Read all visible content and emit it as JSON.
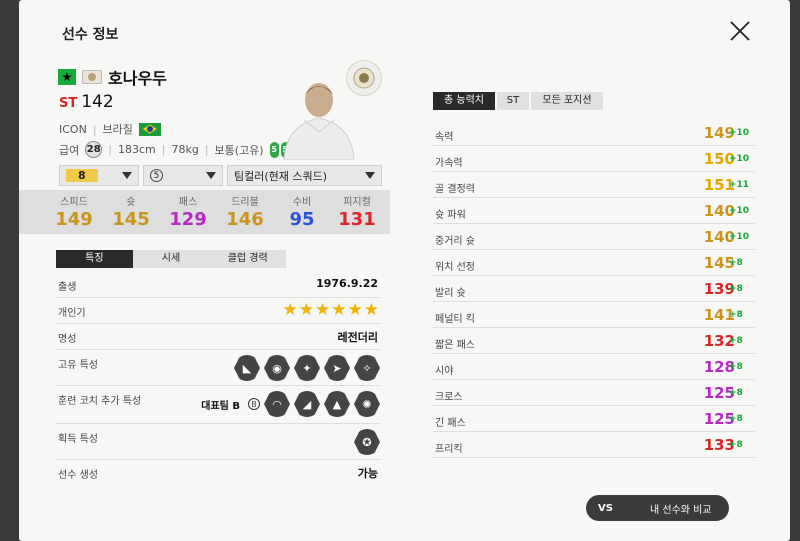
{
  "header": {
    "title": "선수 정보"
  },
  "player": {
    "name": "호나우두",
    "position": "ST",
    "overall": "142",
    "card_type": "ICON",
    "nation": "브라질",
    "salary_label": "급여",
    "salary": "28",
    "height": "183cm",
    "weight": "78kg",
    "body_type": "보통(고유)",
    "left_foot": "5",
    "right_foot": "5"
  },
  "selectors": {
    "level": "8",
    "grade": "5",
    "team_color": "팀컬러(현재 스쿼드)"
  },
  "summary_stats": [
    {
      "label": "스피드",
      "value": "149",
      "color": "#c9951d"
    },
    {
      "label": "슛",
      "value": "145",
      "color": "#c9951d"
    },
    {
      "label": "패스",
      "value": "129",
      "color": "#b42bc4"
    },
    {
      "label": "드리블",
      "value": "146",
      "color": "#c9951d"
    },
    {
      "label": "수비",
      "value": "95",
      "color": "#2a55d6"
    },
    {
      "label": "피지컬",
      "value": "131",
      "color": "#d9262b"
    }
  ],
  "left_tabs": [
    "특징",
    "시세",
    "클럽 경력"
  ],
  "info": {
    "birth_label": "출생",
    "birth": "1976.9.22",
    "popularity_label": "개인기",
    "popularity_stars": "★★★★★★",
    "reputation_label": "명성",
    "reputation": "레전더리",
    "unique_traits_label": "고유 특성",
    "coach_traits_label": "훈련 코치 추가 특성",
    "coach_team": "대표팀 B",
    "acquired_traits_label": "획득 특성",
    "player_creation_label": "선수 생성",
    "player_creation": "가능"
  },
  "right_tabs": [
    "총 능력치",
    "ST",
    "모든 포지션"
  ],
  "attributes": [
    {
      "name": "속력",
      "value": "149",
      "bonus": "+10",
      "color": "#c9951d"
    },
    {
      "name": "가속력",
      "value": "150",
      "bonus": "+10",
      "color": "#e0a800"
    },
    {
      "name": "골 결정력",
      "value": "151",
      "bonus": "+11",
      "color": "#e0a800"
    },
    {
      "name": "슛 파워",
      "value": "140",
      "bonus": "+10",
      "color": "#c9951d"
    },
    {
      "name": "중거리 슛",
      "value": "140",
      "bonus": "+10",
      "color": "#c9951d"
    },
    {
      "name": "위치 선정",
      "value": "145",
      "bonus": "+8",
      "color": "#c9951d"
    },
    {
      "name": "발리 슛",
      "value": "139",
      "bonus": "+8",
      "color": "#d9262b"
    },
    {
      "name": "페널티 킥",
      "value": "141",
      "bonus": "+8",
      "color": "#c9951d"
    },
    {
      "name": "짧은 패스",
      "value": "132",
      "bonus": "+8",
      "color": "#d9262b"
    },
    {
      "name": "시야",
      "value": "128",
      "bonus": "+8",
      "color": "#b42bc4"
    },
    {
      "name": "크로스",
      "value": "125",
      "bonus": "+8",
      "color": "#b42bc4"
    },
    {
      "name": "긴 패스",
      "value": "125",
      "bonus": "+8",
      "color": "#b42bc4"
    },
    {
      "name": "프리킥",
      "value": "133",
      "bonus": "+8",
      "color": "#d9262b"
    }
  ],
  "compare_button": {
    "vs": "VS",
    "label": "내 선수와 비교"
  }
}
